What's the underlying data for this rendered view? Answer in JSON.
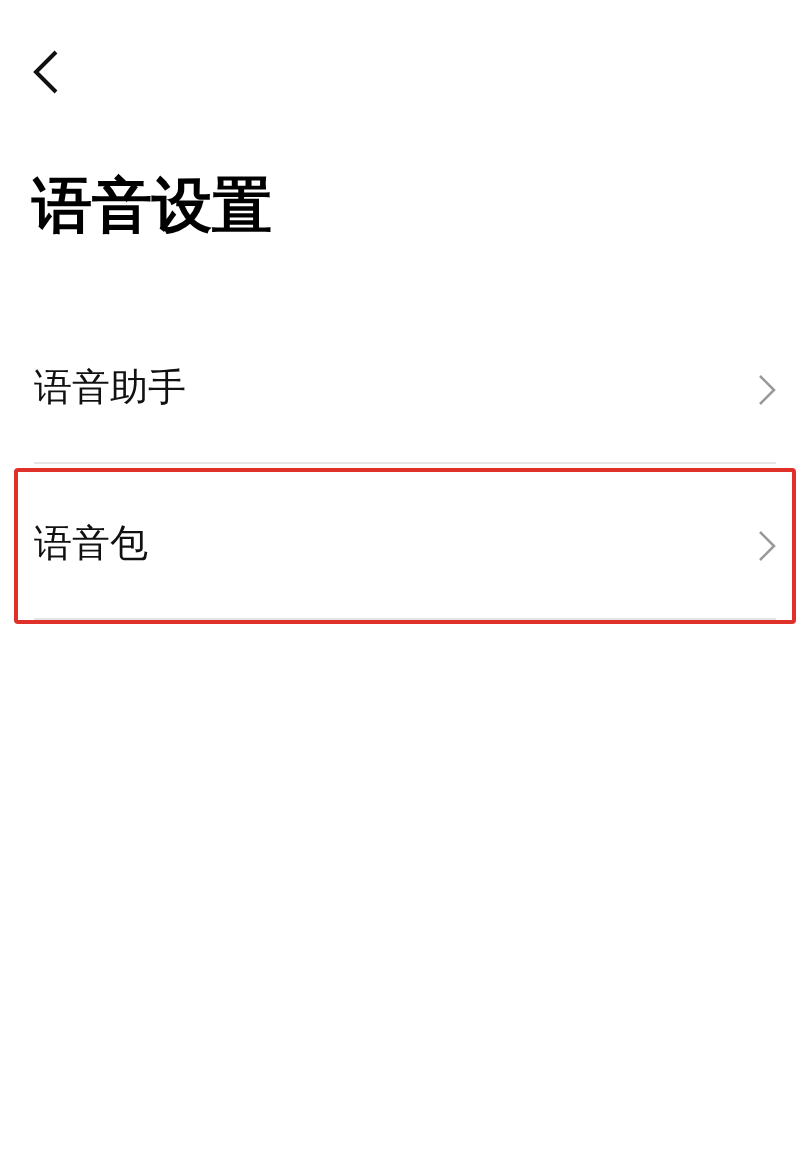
{
  "title": "语音设置",
  "items": [
    {
      "label": "语音助手",
      "highlighted": false
    },
    {
      "label": "语音包",
      "highlighted": true
    }
  ]
}
